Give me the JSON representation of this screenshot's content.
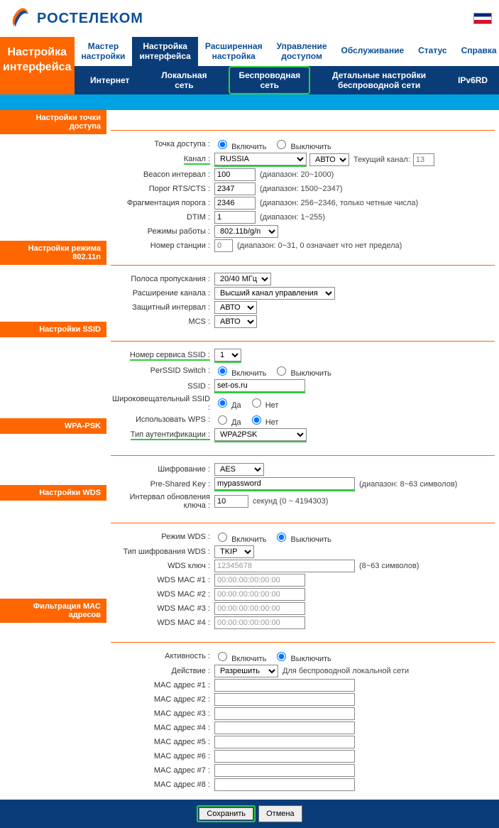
{
  "brand": "РОСТЕЛЕКОМ",
  "left_title_l1": "Настройка",
  "left_title_l2": "интерфейса",
  "top_tabs": {
    "wizard_l1": "Мастер",
    "wizard_l2": "настройки",
    "iface_l1": "Настройка",
    "iface_l2": "интерфейса",
    "adv_l1": "Расширенная",
    "adv_l2": "настройка",
    "access_l1": "Управление",
    "access_l2": "доступом",
    "maint": "Обслуживание",
    "status": "Статус",
    "help": "Справка"
  },
  "sub_tabs": {
    "internet": "Интернет",
    "lan_l1": "Локальная",
    "lan_l2": "сеть",
    "wlan_l1": "Беспроводная",
    "wlan_l2": "сеть",
    "detail_l1": "Детальные настройки",
    "detail_l2": "беспроводной сети",
    "ipv6rd": "IPv6RD"
  },
  "sections": {
    "ap": "Настройки точки доступа",
    "n": "Настройки режима 802.11n",
    "ssid": "Настройки SSID",
    "wpa": "WPA-PSK",
    "wds": "Настройки WDS",
    "mac": "Фильтрация MAC адресов"
  },
  "labels": {
    "ap_point": "Точка доступа :",
    "enable": "Включить",
    "disable": "Выключить",
    "channel": "Канал :",
    "channel_auto": "АВТО",
    "cur_channel": "Текущий канал:",
    "cur_channel_val": "13",
    "beacon": "Beacon интервал :",
    "beacon_val": "100",
    "beacon_hint": "(диапазон: 20~1000)",
    "rts": "Порог RTS/CTS :",
    "rts_val": "2347",
    "rts_hint": "(диапазон: 1500~2347)",
    "frag": "Фрагментация порога :",
    "frag_val": "2346",
    "frag_hint": "(диапазон: 256~2346, только четные числа)",
    "dtim": "DTIM :",
    "dtim_val": "1",
    "dtim_hint": "(диапазон: 1~255)",
    "mode": "Режимы работы :",
    "mode_val": "802.11b/g/n",
    "station": "Номер станции :",
    "station_val": "0",
    "station_hint": "(диапазон: 0~31, 0 означает что нет предела)",
    "bandwidth": "Полоса пропускания :",
    "bandwidth_val": "20/40 МГц",
    "ext": "Расширение канала :",
    "ext_val": "Высший канал управления",
    "guard": "Защитный интервал :",
    "auto": "АВТО",
    "mcs": "MCS :",
    "ssid_num": "Номер сервиса SSID :",
    "ssid_num_val": "1",
    "perssid": "PerSSID Switch :",
    "ssid": "SSID :",
    "ssid_val": "set-os.ru",
    "broadcast": "Широковещательный SSID :",
    "yes": "Да",
    "no": "Нет",
    "wps": "Использовать WPS :",
    "auth": "Тип аутентификации :",
    "auth_val": "WPA2PSK",
    "enc": "Шифрование :",
    "enc_val": "AES",
    "psk": "Pre-Shared Key :",
    "psk_val": "mypassword",
    "psk_hint": "(диапазон: 8~63 символов)",
    "rekey_l1": "Интервал обновления",
    "rekey_l2": "ключа :",
    "rekey_val": "10",
    "rekey_hint": "секунд (0 ~ 4194303)",
    "wds_mode": "Режим WDS :",
    "wds_enc": "Тип шифрования WDS :",
    "wds_enc_val": "TKIP",
    "wds_key": "WDS ключ :",
    "wds_key_val": "12345678",
    "wds_key_hint": "(8~63 символов)",
    "wds_mac": "WDS MAC #",
    "mac_placeholder": "00:00:00:00:00:00",
    "activity": "Активность :",
    "action": "Действие :",
    "action_val": "Разрешить",
    "action_hint": "Для беспроводной локальной сети",
    "mac_addr": "MAC адрес #",
    "channel_country": "RUSSIA"
  },
  "buttons": {
    "save": "Сохранить",
    "cancel": "Отмена"
  }
}
